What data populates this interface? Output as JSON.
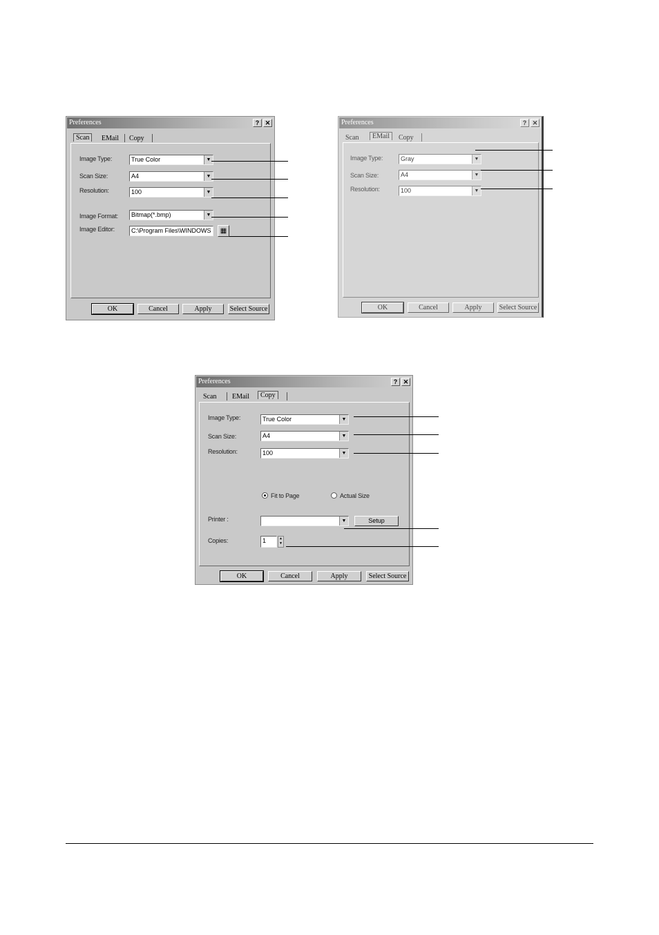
{
  "dialog_scan": {
    "title": "Preferences",
    "help_btn": "?",
    "close_btn": "✕",
    "tabs": [
      "Scan",
      "EMail",
      "Copy"
    ],
    "labels": {
      "image_type": "Image Type:",
      "scan_size": "Scan Size:",
      "resolution": "Resolution:",
      "image_format": "Image Format:",
      "image_editor": "Image Editor:"
    },
    "values": {
      "image_type": "True Color",
      "scan_size": "A4",
      "resolution": "100",
      "image_format": "Bitmap(*.bmp)",
      "image_editor": "C:\\Program Files\\WINDOWS"
    },
    "buttons": [
      "OK",
      "Cancel",
      "Apply",
      "Select Source"
    ]
  },
  "dialog_email": {
    "title": "Preferences",
    "help_btn": "?",
    "close_btn": "✕",
    "tabs": [
      "Scan",
      "EMail",
      "Copy"
    ],
    "labels": {
      "image_type": "Image Type:",
      "scan_size": "Scan Size:",
      "resolution": "Resolution:"
    },
    "values": {
      "image_type": "Gray",
      "scan_size": "A4",
      "resolution": "100"
    },
    "buttons": [
      "OK",
      "Cancel",
      "Apply",
      "Select Source"
    ]
  },
  "dialog_copy": {
    "title": "Preferences",
    "help_btn": "?",
    "close_btn": "✕",
    "tabs": [
      "Scan",
      "EMail",
      "Copy"
    ],
    "labels": {
      "image_type": "Image Type:",
      "scan_size": "Scan Size:",
      "resolution": "Resolution:",
      "printer": "Printer :",
      "copies": "Copies:"
    },
    "values": {
      "image_type": "True Color",
      "scan_size": "A4",
      "resolution": "100",
      "printer": "",
      "copies": "1"
    },
    "radio": {
      "fit_to_page": "Fit to Page",
      "actual_size": "Actual Size",
      "selected": "fit_to_page"
    },
    "setup_button": "Setup",
    "buttons": [
      "OK",
      "Cancel",
      "Apply",
      "Select Source"
    ]
  },
  "icons": {
    "dropdown": "▼",
    "spin_up": "▲",
    "spin_down": "▼",
    "browse": "▦"
  }
}
